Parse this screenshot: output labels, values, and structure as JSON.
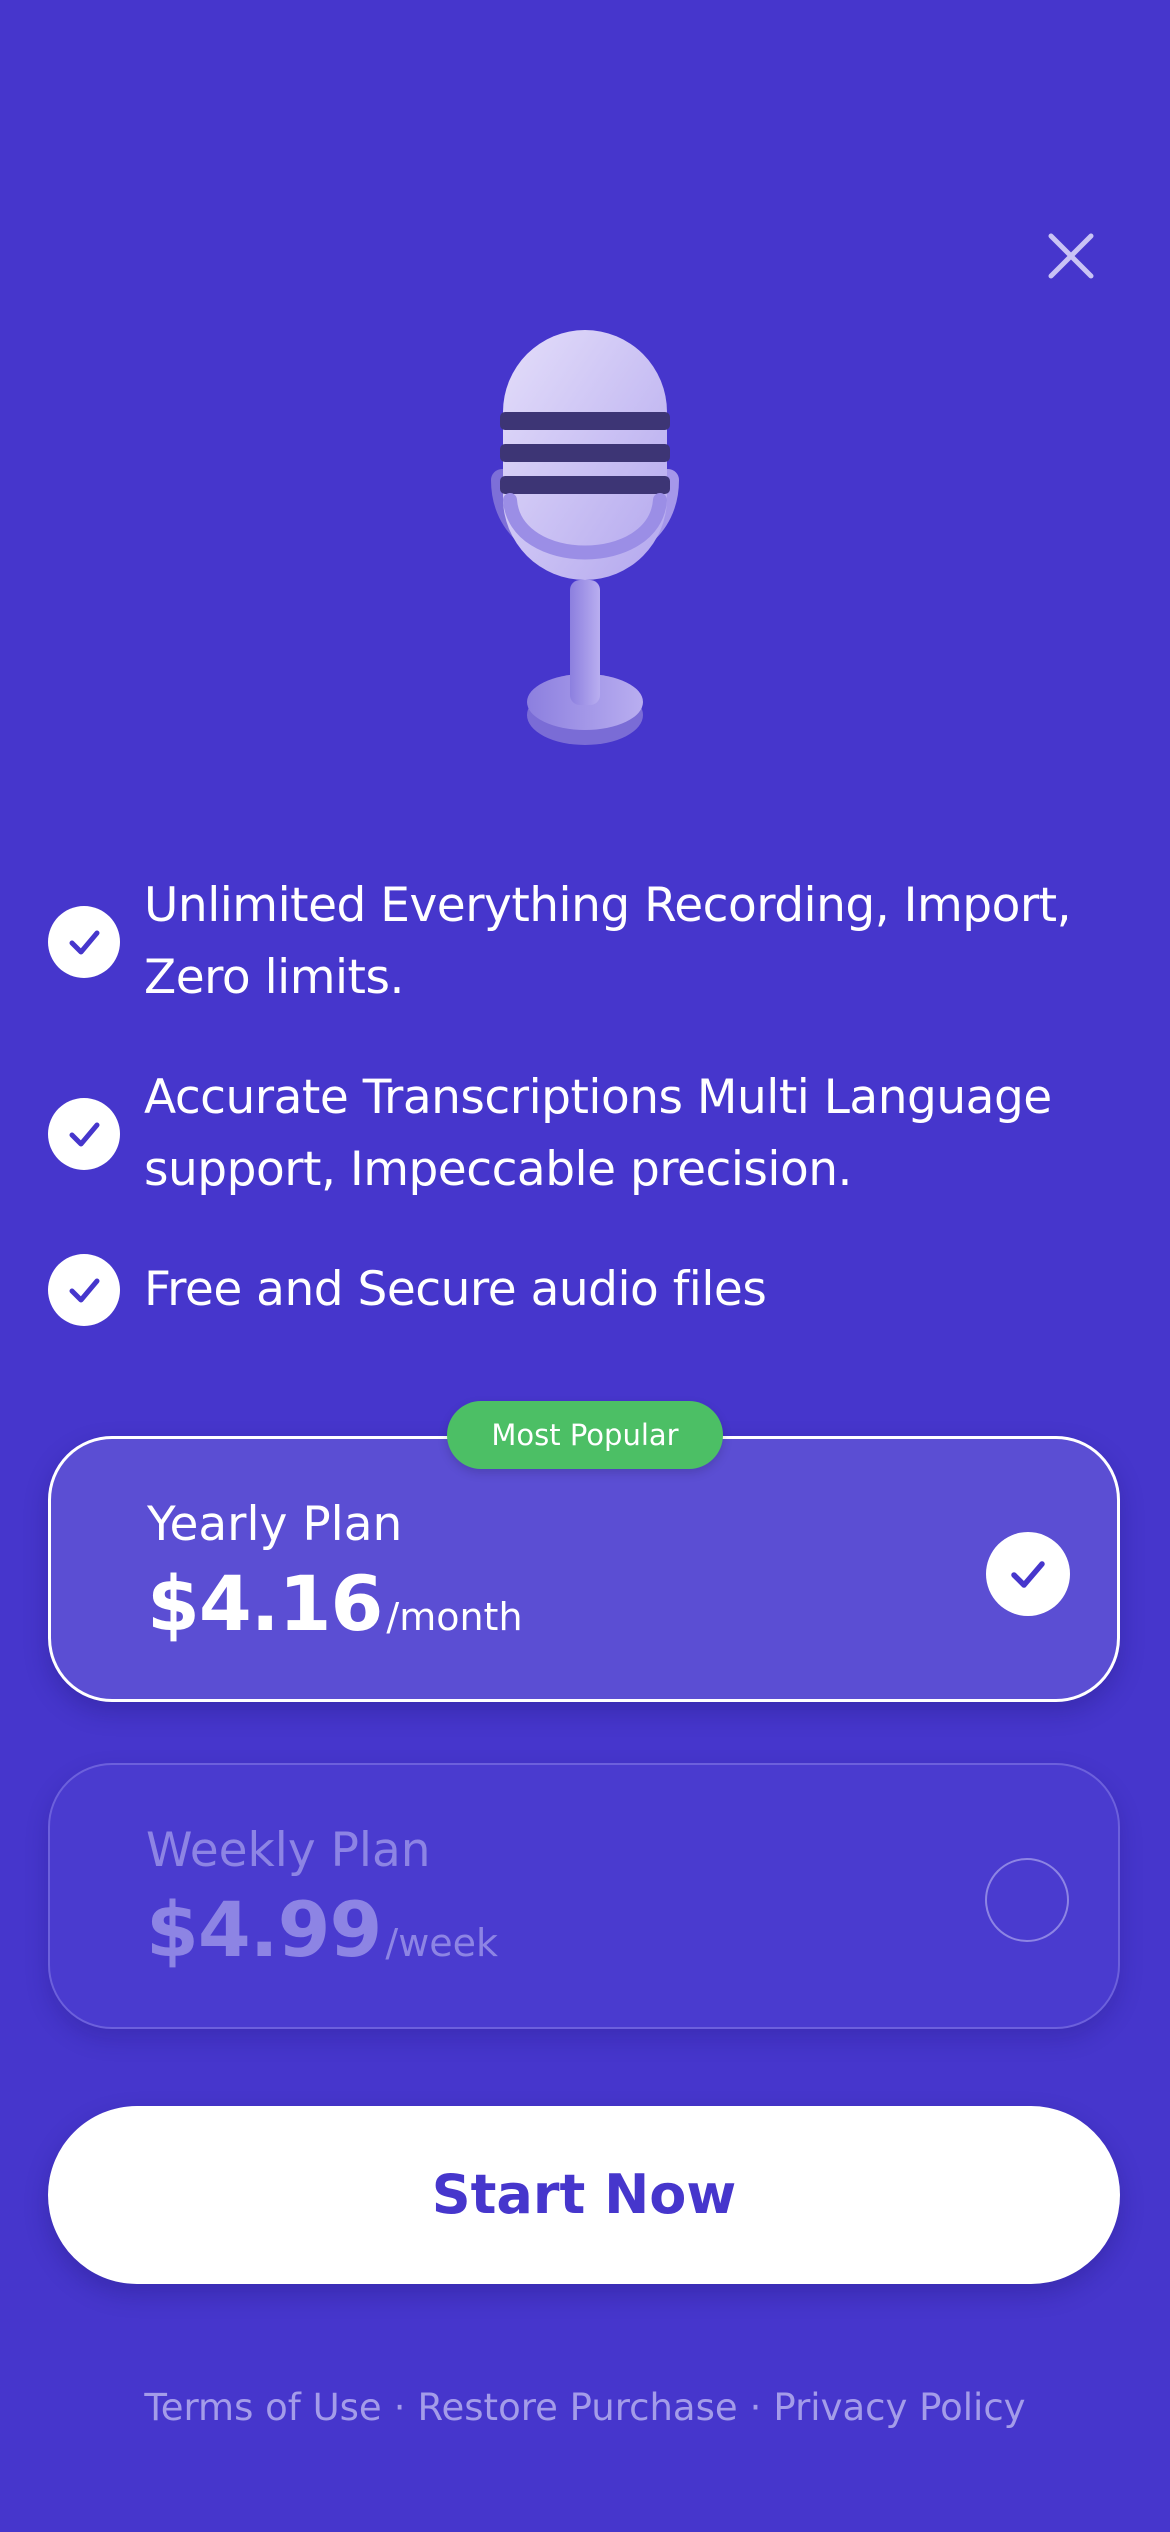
{
  "colors": {
    "background": "#4636cc",
    "accent_green": "#4cbf65",
    "selected_plan_bg": "#5b4ed3",
    "muted_text": "#8d84e4"
  },
  "header": {
    "close_icon": "close-icon"
  },
  "hero": {
    "icon": "microphone-icon"
  },
  "features": [
    {
      "icon": "check-icon",
      "text": "Unlimited Everything Recording, Import, Zero limits."
    },
    {
      "icon": "check-icon",
      "text": "Accurate Transcriptions Multi Language support, Impeccable precision."
    },
    {
      "icon": "check-icon",
      "text": "Free and Secure audio files"
    }
  ],
  "plans": {
    "badge": "Most Popular",
    "yearly": {
      "name": "Yearly Plan",
      "price": "$4.16",
      "period": "/month",
      "selected": true
    },
    "weekly": {
      "name": "Weekly Plan",
      "price": "$4.99",
      "period": "/week",
      "selected": false
    }
  },
  "cta": {
    "label": "Start Now"
  },
  "footer": {
    "terms": "Terms of Use",
    "restore": "Restore Purchase",
    "privacy": "Privacy Policy",
    "separator": "·"
  }
}
